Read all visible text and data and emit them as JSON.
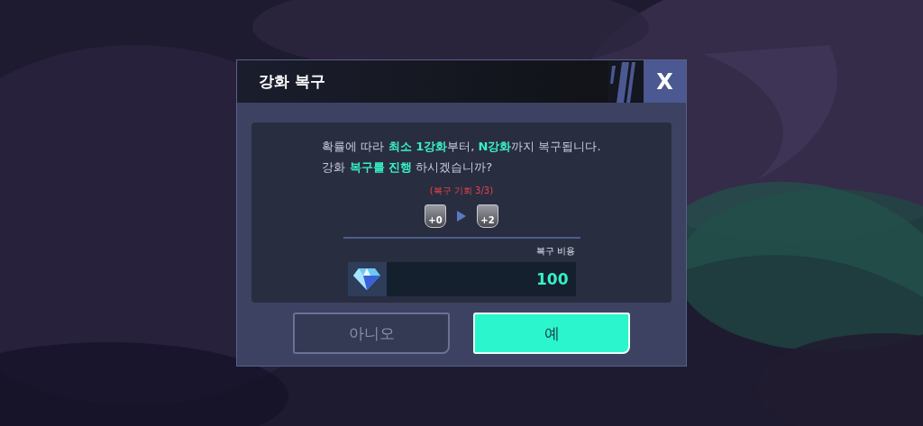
{
  "dialog": {
    "title": "강화 복구",
    "close": "X",
    "message": [
      "확률에 따라 **최소 1강화**부터, **N강화**까지 복구됩니다.",
      "강화 **복구를 진행** 하시겠습니까?"
    ],
    "chances": "(복구 기회 3/3)",
    "upgrade": {
      "from": "+0",
      "to": "+2"
    },
    "cost": {
      "label": "복구 비용",
      "value": "100"
    },
    "buttons": [
      {
        "label": "아니오",
        "kind": "secondary"
      },
      {
        "label": "예",
        "kind": "primary"
      }
    ]
  }
}
